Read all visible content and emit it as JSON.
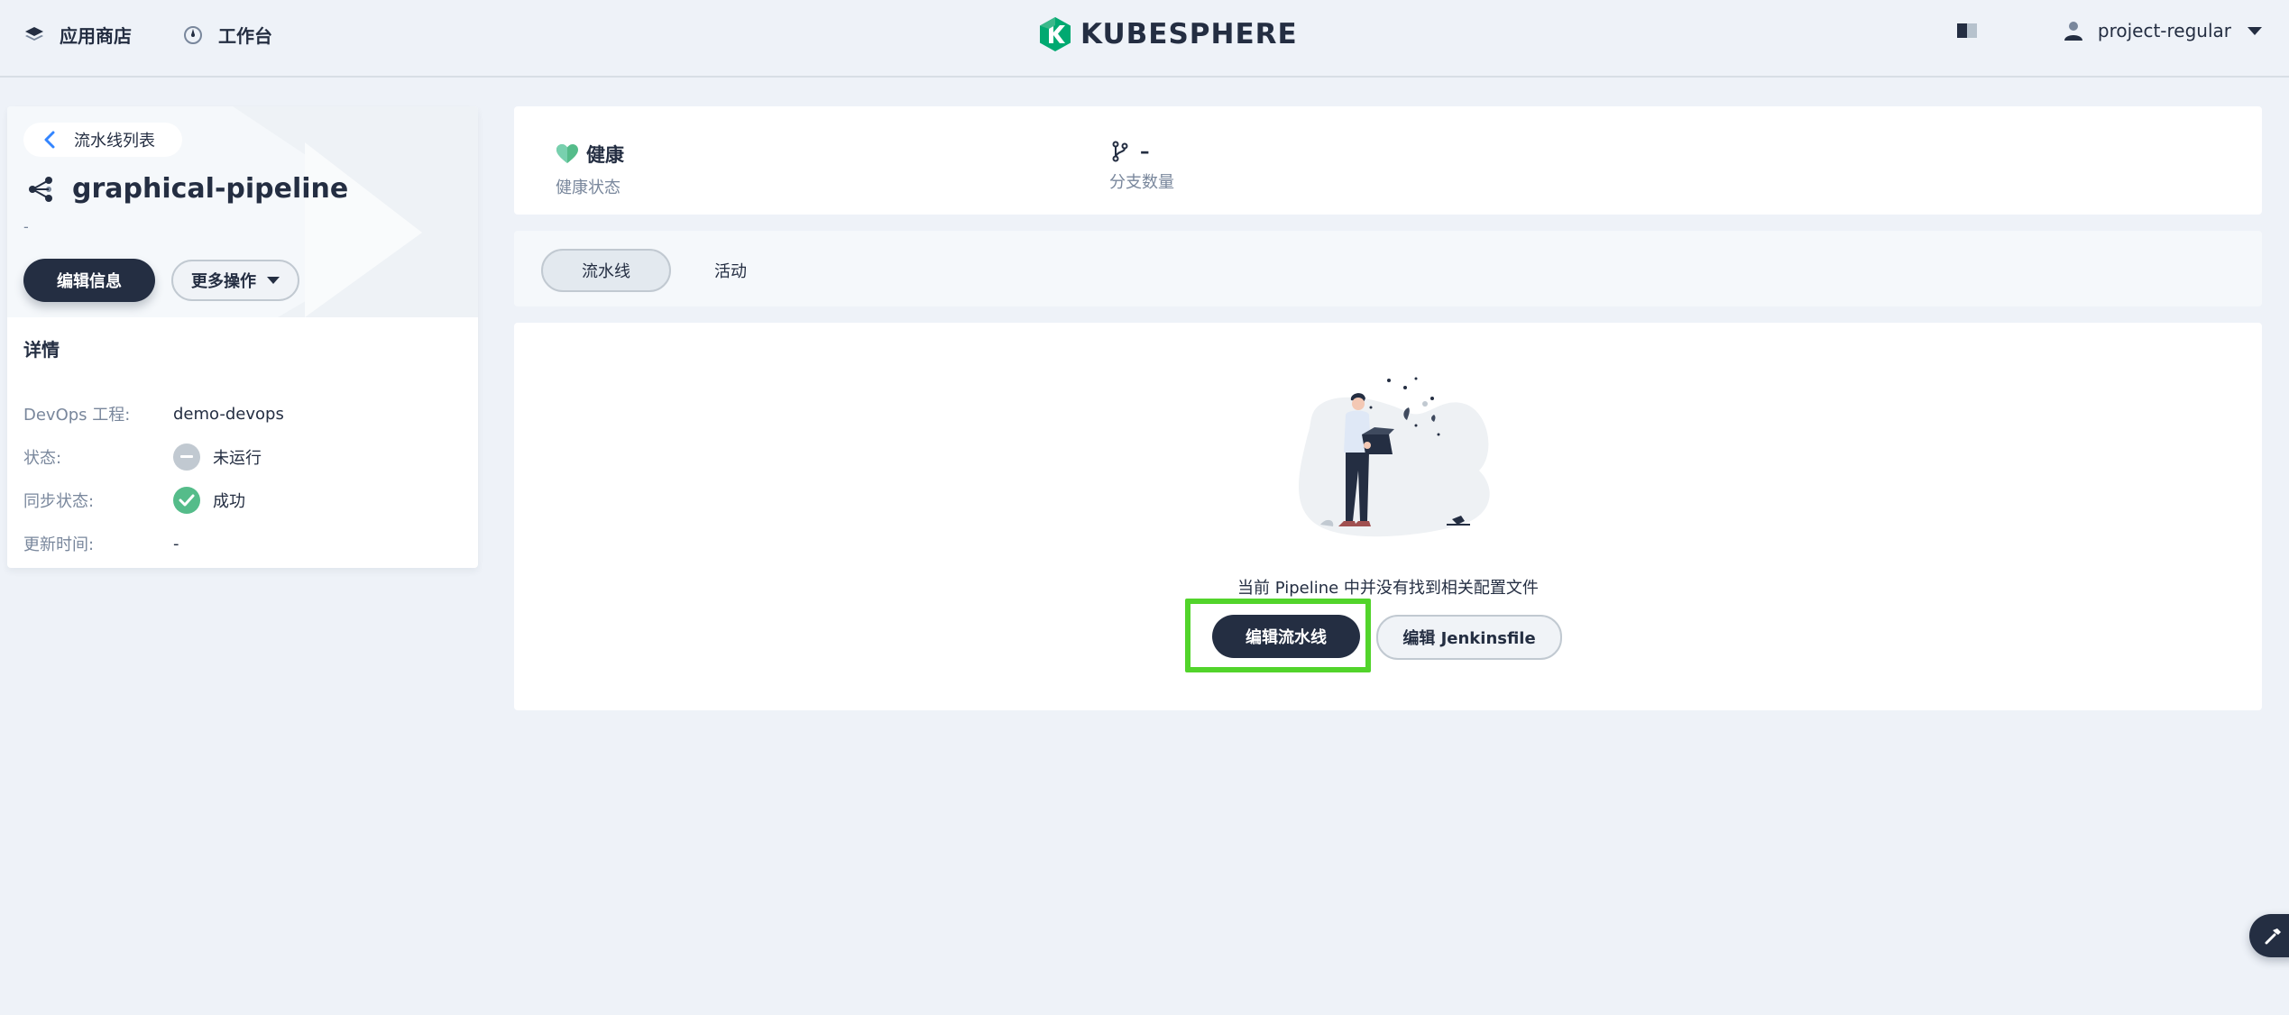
{
  "navbar": {
    "app_store": "应用商店",
    "workbench": "工作台",
    "brand": "KUBESPHERE",
    "username": "project-regular",
    "colors": {
      "brand_green": "#00a971",
      "brand_dark": "#3ab88a"
    }
  },
  "sidebar": {
    "back_label": "流水线列表",
    "title": "graphical-pipeline",
    "description": "-",
    "edit_info_label": "编辑信息",
    "more_actions_label": "更多操作",
    "details_heading": "详情",
    "details": [
      {
        "key": "DevOps 工程:",
        "value": "demo-devops"
      },
      {
        "key": "状态:",
        "value": "未运行",
        "icon": "minus-circle-icon"
      },
      {
        "key": "同步状态:",
        "value": "成功",
        "icon": "check-circle-icon"
      },
      {
        "key": "更新时间:",
        "value": "-"
      }
    ]
  },
  "summary": {
    "health_value": "健康",
    "health_label": "健康状态",
    "branch_value": "–",
    "branch_label": "分支数量"
  },
  "tabs": [
    {
      "label": "流水线",
      "active": true
    },
    {
      "label": "活动",
      "active": false
    }
  ],
  "empty_state": {
    "message": "当前 Pipeline 中并没有找到相关配置文件",
    "edit_pipeline_label": "编辑流水线",
    "edit_jenkinsfile_label": "编辑 Jenkinsfile"
  },
  "colors": {
    "page_bg": "#eef2f8",
    "dark": "#242e42",
    "muted": "#79879c",
    "success": "#55bc8a",
    "highlight": "#52d42b"
  }
}
